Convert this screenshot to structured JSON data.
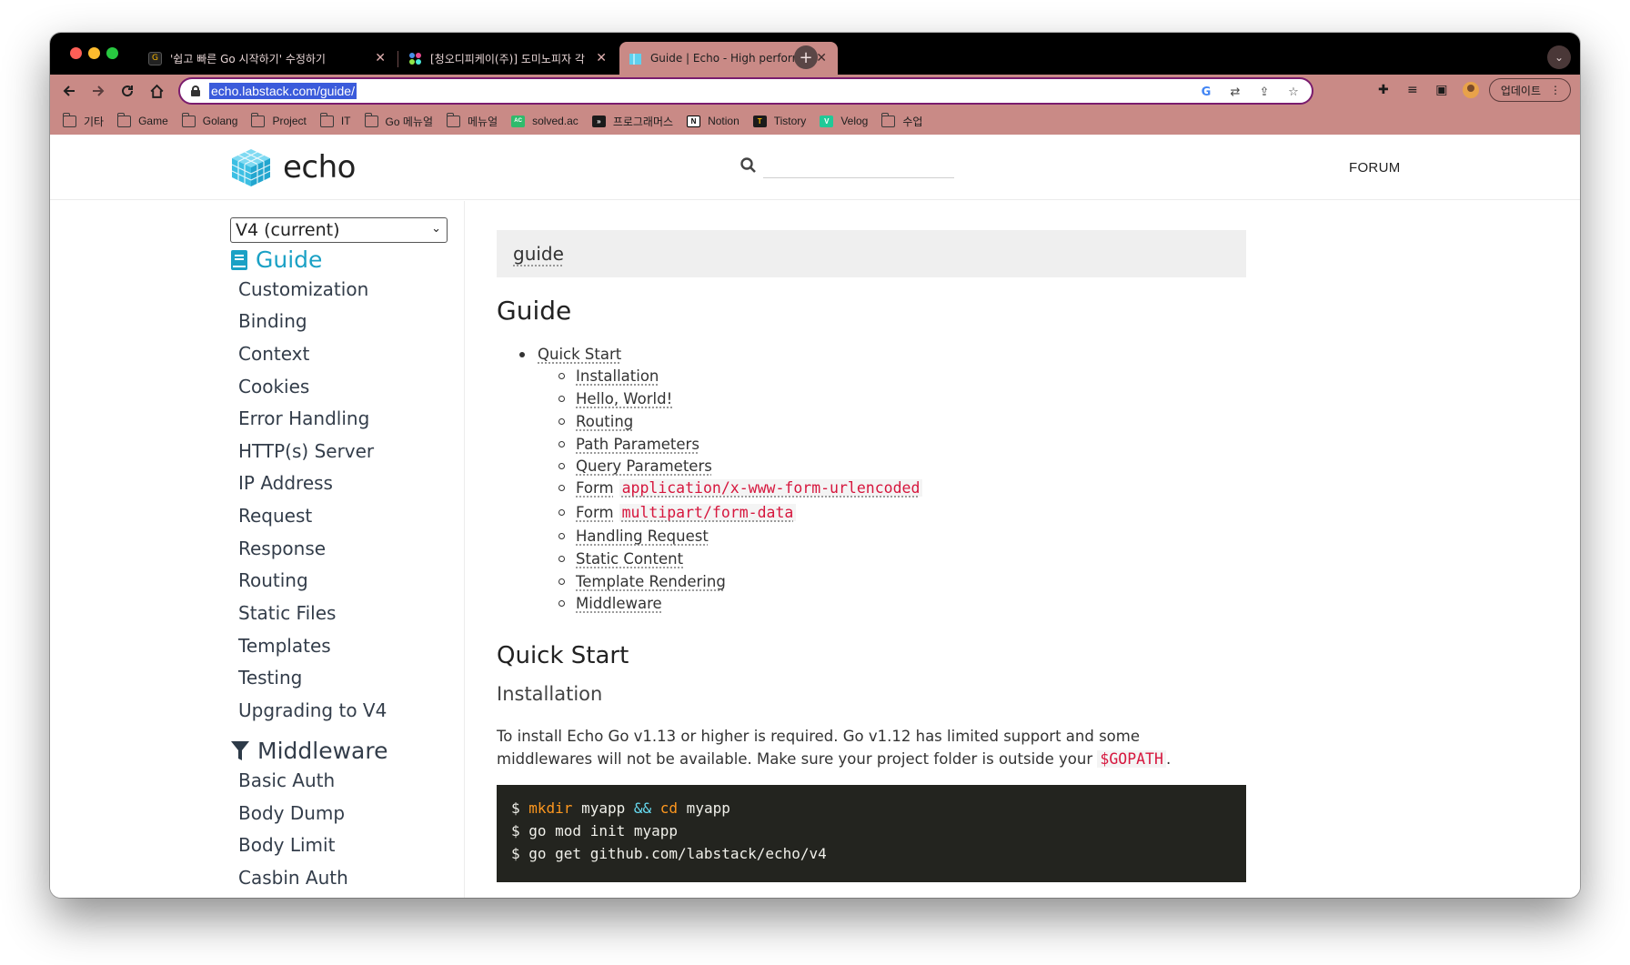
{
  "browser": {
    "tabs": [
      {
        "title": "'쉽고 빠른 Go 시작하기' 수정하기",
        "active": false
      },
      {
        "title": "[청오디피케이(주)] 도미노피자 각 부",
        "active": false
      },
      {
        "title": "Guide | Echo - High performance",
        "active": true
      }
    ],
    "new_tab": "+",
    "url": "echo.labstack.com/guide/",
    "update_label": "업데이트",
    "bookmarks": [
      "기타",
      "Game",
      "Golang",
      "Project",
      "IT",
      "Go 메뉴얼",
      "메뉴얼",
      "solved.ac",
      "프로그래머스",
      "Notion",
      "Tistory",
      "Velog",
      "수업"
    ]
  },
  "site": {
    "logo_text": "echo",
    "search_placeholder": "",
    "forum_label": "FORUM"
  },
  "sidebar": {
    "version": "V4 (current)",
    "guide_label": "Guide",
    "guide_items": [
      "Customization",
      "Binding",
      "Context",
      "Cookies",
      "Error Handling",
      "HTTP(s) Server",
      "IP Address",
      "Request",
      "Response",
      "Routing",
      "Static Files",
      "Templates",
      "Testing",
      "Upgrading to V4"
    ],
    "middleware_label": "Middleware",
    "middleware_items": [
      "Basic Auth",
      "Body Dump",
      "Body Limit",
      "Casbin Auth"
    ]
  },
  "main": {
    "breadcrumb": "guide",
    "title": "Guide",
    "toc_top": "Quick Start",
    "toc_items": [
      {
        "text": "Installation"
      },
      {
        "text": "Hello, World!"
      },
      {
        "text": "Routing"
      },
      {
        "text": "Path Parameters"
      },
      {
        "text": "Query Parameters"
      },
      {
        "text": "Form",
        "code": "application/x-www-form-urlencoded"
      },
      {
        "text": "Form",
        "code": "multipart/form-data"
      },
      {
        "text": "Handling Request"
      },
      {
        "text": "Static Content"
      },
      {
        "text": "Template Rendering"
      },
      {
        "text": "Middleware"
      }
    ],
    "section_title": "Quick Start",
    "subsection_title": "Installation",
    "para_1": "To install Echo Go v1.13 or higher is required. Go v1.12 has limited support and some",
    "para_2": "middlewares will not be available. Make sure your project folder is outside your",
    "para_code": "$GOPATH",
    "para_end": ".",
    "code": {
      "line1_prompt": "$ ",
      "line1_cmd": "mkdir",
      "line1_arg": " myapp ",
      "line1_op": "&&",
      "line1_cmd2": " cd",
      "line1_arg2": " myapp",
      "line2": "$ go mod init myapp",
      "line3": "$ go get github.com/labstack/echo/v4"
    }
  },
  "colors": {
    "accent": "#1ba1c5",
    "code_red": "#d6163d",
    "chrome_theme": "#c98a86"
  }
}
